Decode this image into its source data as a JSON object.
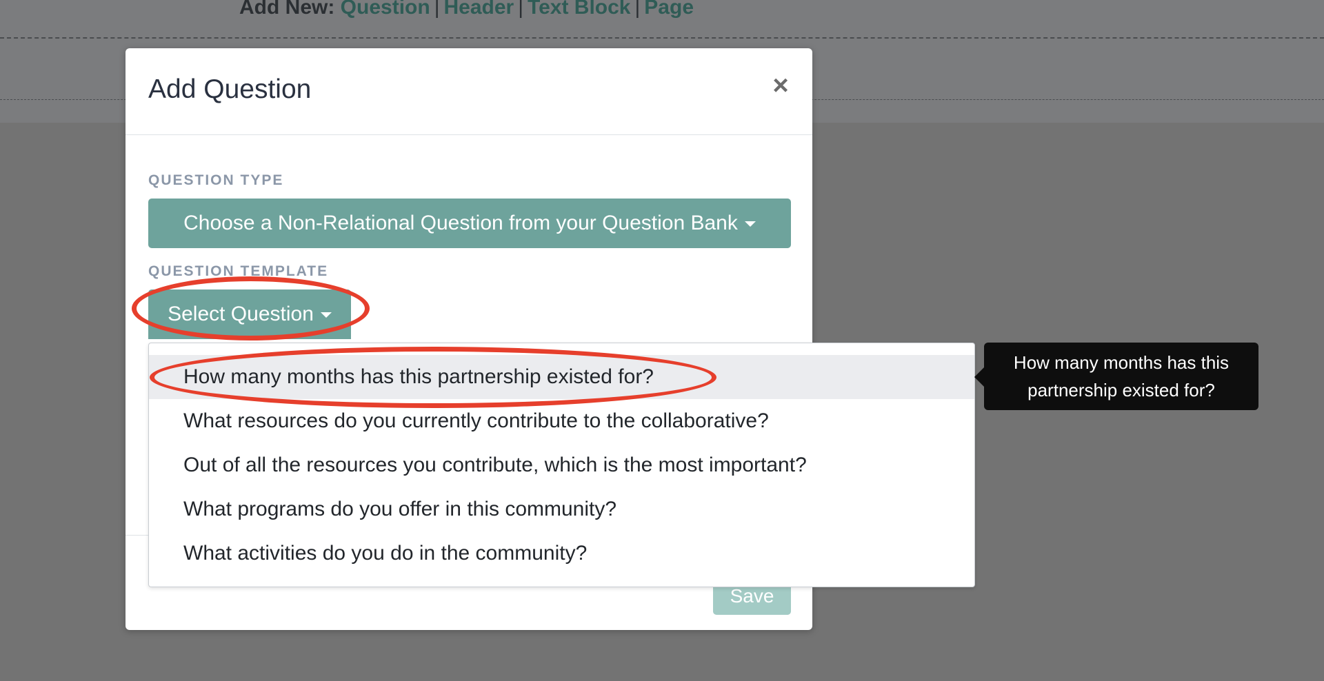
{
  "background": {
    "add_new_label": "Add New:",
    "links": [
      "Question",
      "Header",
      "Text Block",
      "Page"
    ],
    "separator": "|"
  },
  "modal": {
    "title": "Add Question",
    "close_symbol": "×",
    "question_type_label": "QUESTION TYPE",
    "question_type_button": "Choose a Non-Relational Question from your Question Bank",
    "question_template_label": "QUESTION TEMPLATE",
    "select_question_button": "Select Question",
    "save_label": "Save"
  },
  "dropdown": {
    "items": [
      "How many months has this partnership existed for?",
      "What resources do you currently contribute to the collaborative?",
      "Out of all the resources you contribute, which is the most important?",
      "What programs do you offer in this community?",
      "What activities do you do in the community?"
    ],
    "active_index": 0
  },
  "tooltip": {
    "line1": "How many months has this",
    "line2": "partnership existed for?"
  },
  "colors": {
    "accent": "#6ea39c",
    "annotation": "#e63f2c",
    "overlay": "#737373"
  }
}
